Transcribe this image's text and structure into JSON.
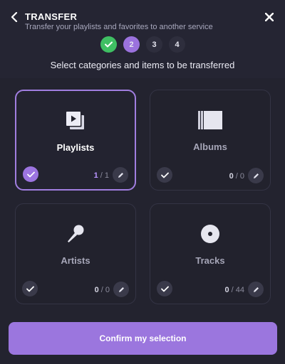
{
  "header": {
    "title": "TRANSFER",
    "subtitle": "Transfer your playlists and favorites to another service",
    "back_icon": "chevron-left-icon",
    "close_icon": "close-icon"
  },
  "steps": [
    {
      "label": "✓",
      "state": "done"
    },
    {
      "label": "2",
      "state": "active"
    },
    {
      "label": "3",
      "state": "upcoming"
    },
    {
      "label": "4",
      "state": "upcoming"
    }
  ],
  "instruction": "Select categories and items to be transferred",
  "categories": [
    {
      "label": "Playlists",
      "icon": "playlist-icon",
      "selected": "1",
      "total": "1",
      "is_selected": true
    },
    {
      "label": "Albums",
      "icon": "album-icon",
      "selected": "0",
      "total": "0",
      "is_selected": false
    },
    {
      "label": "Artists",
      "icon": "microphone-icon",
      "selected": "0",
      "total": "0",
      "is_selected": false
    },
    {
      "label": "Tracks",
      "icon": "disc-icon",
      "selected": "0",
      "total": "44",
      "is_selected": false
    }
  ],
  "confirm_label": "Confirm my selection",
  "colors": {
    "background": "#23232f",
    "accent": "#9b76de",
    "success": "#3fbf63"
  }
}
